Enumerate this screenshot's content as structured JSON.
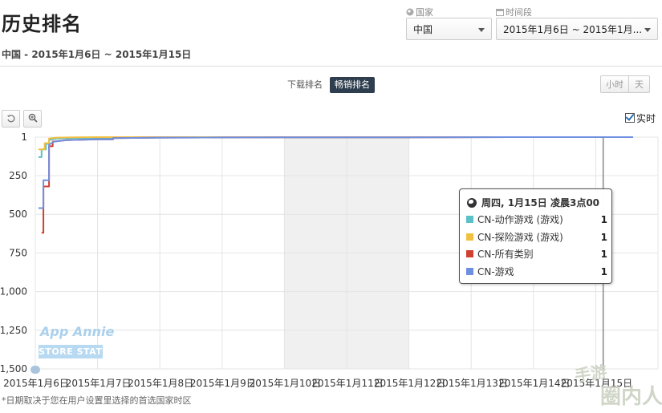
{
  "header": {
    "title": "历史排名",
    "subtitle": "中国 - 2015年1月6日 ~ 2015年1月15日"
  },
  "filters": {
    "country_label": "国家",
    "country_value": "中国",
    "period_label": "时间段",
    "period_value": "2015年1月6日 ~ 2015年1月..."
  },
  "rank_tabs": {
    "download": "下载排名",
    "sales": "畅销排名",
    "active": "sales"
  },
  "granularity": {
    "hour": "小时",
    "day": "天"
  },
  "realtime_label": "实时",
  "tooltip": {
    "header": "周四, 1月15日 凌晨3点00",
    "rows": [
      {
        "label": "CN-动作游戏 (游戏)",
        "value": "1",
        "color": "#5bc0c8"
      },
      {
        "label": "CN-探险游戏 (游戏)",
        "value": "1",
        "color": "#f0c040"
      },
      {
        "label": "CN-所有类别",
        "value": "1",
        "color": "#d04030"
      },
      {
        "label": "CN-游戏",
        "value": "1",
        "color": "#6f8fe0"
      }
    ]
  },
  "footnote": "*日期取决于您在用户设置里选择的首选国家时区",
  "watermark": {
    "line1": "App Annie",
    "line2": "STORE STATS"
  },
  "corner_logo": {
    "line1": "手游",
    "line2": "圈内人"
  },
  "chart_data": {
    "type": "line",
    "y_reversed": true,
    "ylim": [
      1,
      1500
    ],
    "yticks": [
      1,
      250,
      500,
      750,
      1000,
      1250,
      1500
    ],
    "ytick_labels": [
      "1",
      "250",
      "500",
      "750",
      "1,000",
      "1,250",
      "1,500"
    ],
    "xlim": [
      6,
      16
    ],
    "xticks": [
      6,
      7,
      8,
      9,
      10,
      11,
      12,
      13,
      14,
      15
    ],
    "xtick_labels": [
      "2015年1月6日",
      "2015年1月7日",
      "2015年1月8日",
      "2015年1月9日",
      "2015年1月10日",
      "2015年1月11日",
      "2015年1月12日",
      "2015年1月13日",
      "2015年1月14日",
      "2015年1月15日"
    ],
    "weekend_bands": [
      [
        10,
        12
      ]
    ],
    "crosshair_x": 15.12,
    "series": [
      {
        "name": "CN-动作游戏 (游戏)",
        "color": "#5bc0c8",
        "points": [
          [
            6.05,
            130
          ],
          [
            6.1,
            130
          ],
          [
            6.1,
            80
          ],
          [
            6.17,
            80
          ],
          [
            6.17,
            45
          ],
          [
            6.22,
            45
          ],
          [
            6.22,
            20
          ],
          [
            6.35,
            10
          ],
          [
            6.6,
            8
          ],
          [
            7.0,
            6
          ],
          [
            8.0,
            4
          ],
          [
            9.0,
            3
          ],
          [
            10.0,
            2
          ],
          [
            12.0,
            2
          ],
          [
            14.0,
            1
          ],
          [
            15.6,
            1
          ]
        ]
      },
      {
        "name": "CN-探险游戏 (游戏)",
        "color": "#f0c040",
        "points": [
          [
            6.05,
            80
          ],
          [
            6.15,
            80
          ],
          [
            6.15,
            40
          ],
          [
            6.22,
            40
          ],
          [
            6.22,
            10
          ],
          [
            6.35,
            4
          ],
          [
            6.6,
            2
          ],
          [
            7.0,
            1
          ],
          [
            15.6,
            1
          ]
        ]
      },
      {
        "name": "CN-所有类别",
        "color": "#d04030",
        "points": [
          [
            6.1,
            620
          ],
          [
            6.13,
            620
          ],
          [
            6.13,
            320
          ],
          [
            6.22,
            320
          ],
          [
            6.22,
            60
          ],
          [
            6.28,
            60
          ],
          [
            6.28,
            30
          ],
          [
            6.5,
            20
          ],
          [
            7.0,
            15
          ],
          [
            7.25,
            15
          ],
          [
            7.25,
            7
          ],
          [
            8.0,
            4
          ],
          [
            9.0,
            3
          ],
          [
            10.0,
            2
          ],
          [
            12.0,
            2
          ],
          [
            14.0,
            1
          ],
          [
            15.6,
            1
          ]
        ]
      },
      {
        "name": "CN-游戏",
        "color": "#6f8fe0",
        "points": [
          [
            6.05,
            460
          ],
          [
            6.13,
            460
          ],
          [
            6.13,
            280
          ],
          [
            6.22,
            280
          ],
          [
            6.22,
            50
          ],
          [
            6.3,
            30
          ],
          [
            6.5,
            20
          ],
          [
            7.0,
            15
          ],
          [
            7.25,
            15
          ],
          [
            7.25,
            7
          ],
          [
            8.0,
            4
          ],
          [
            9.0,
            3
          ],
          [
            10.0,
            2
          ],
          [
            12.0,
            2
          ],
          [
            14.0,
            1
          ],
          [
            15.6,
            1
          ]
        ]
      }
    ]
  }
}
